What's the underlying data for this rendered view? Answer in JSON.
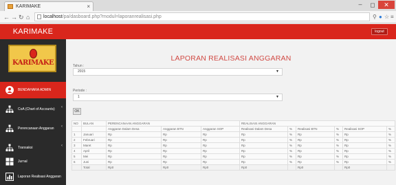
{
  "browser": {
    "tab_title": "KARIMAKE",
    "tab_close": "×",
    "window_controls": [
      "–",
      "◻",
      "✕"
    ],
    "url_host": "localhost",
    "url_path": "/pa/dasboard.php?modul=laporanrealisasi.php",
    "nav_icons": [
      "arrow-left-icon",
      "arrow-right-icon",
      "reload-icon",
      "home-icon"
    ],
    "ext_icons": [
      "search-icon",
      "extension-icon",
      "star-icon",
      "menu-icon"
    ]
  },
  "header": {
    "brand": "KARIMAKE",
    "logout_label": "logout"
  },
  "sidebar": {
    "logo_text": "KARIMAKE",
    "items": [
      {
        "label": "BENDAHARA ADMIN",
        "icon": "user-icon",
        "active": true
      },
      {
        "label": "CoA (Chart of Accounts)",
        "icon": "sitemap-icon",
        "active": false
      },
      {
        "label": "Perencanaan Anggaran",
        "icon": "sitemap-icon",
        "active": false
      },
      {
        "label": "Transaksi",
        "icon": "sitemap-icon",
        "active": false
      },
      {
        "label": "Jurnal",
        "icon": "grid-icon",
        "active": false
      },
      {
        "label": "Laporan Realisasi Anggaran",
        "icon": "chart-icon",
        "active": false
      }
    ]
  },
  "content": {
    "title": "LAPORAN REALISASI ANGGARAN",
    "tahun_label": "Tahun :",
    "tahun_value": "2015",
    "periode_label": "Periode :",
    "periode_value": "1",
    "ok_label": "OK"
  },
  "table": {
    "header_row1": [
      "NO",
      "BULAN",
      "PERENCANAAN ANGGARAN",
      "REALISASI ANGGARAN"
    ],
    "header_row2": [
      "Anggaran Dalam Desa",
      "Anggaran BTN",
      "Anggaran SOP",
      "Realisasi Dalam Desa",
      "%",
      "Realisasi BTN",
      "%",
      "Realisasi SOP",
      "%"
    ],
    "rows": [
      {
        "no": "1",
        "bulan": "Januari",
        "cells": [
          "Rp",
          "Rp",
          "Rp",
          "Rp",
          "%",
          "Rp",
          "%",
          "Rp",
          "%"
        ]
      },
      {
        "no": "2",
        "bulan": "Februari",
        "cells": [
          "Rp",
          "Rp",
          "Rp",
          "Rp",
          "%",
          "Rp",
          "%",
          "Rp",
          "%"
        ]
      },
      {
        "no": "3",
        "bulan": "Maret",
        "cells": [
          "Rp",
          "Rp",
          "Rp",
          "Rp",
          "%",
          "Rp",
          "%",
          "Rp",
          "%"
        ]
      },
      {
        "no": "4",
        "bulan": "April",
        "cells": [
          "Rp",
          "Rp",
          "Rp",
          "Rp",
          "%",
          "Rp",
          "%",
          "Rp",
          "%"
        ]
      },
      {
        "no": "5",
        "bulan": "Mei",
        "cells": [
          "Rp",
          "Rp",
          "Rp",
          "Rp",
          "%",
          "Rp",
          "%",
          "Rp",
          "%"
        ]
      },
      {
        "no": "6",
        "bulan": "Juni",
        "cells": [
          "Rp",
          "Rp",
          "Rp",
          "Rp",
          "%",
          "Rp",
          "%",
          "Rp",
          "%"
        ]
      }
    ],
    "total": {
      "label": "Total",
      "cells": [
        "Rp0",
        "Rp0",
        "Rp0",
        "Rp0",
        "",
        "Rp0",
        "",
        "Rp0",
        ""
      ]
    }
  },
  "colors": {
    "accent": "#d9261c",
    "sidebar": "#2a2a2a",
    "title": "#d14a44"
  }
}
